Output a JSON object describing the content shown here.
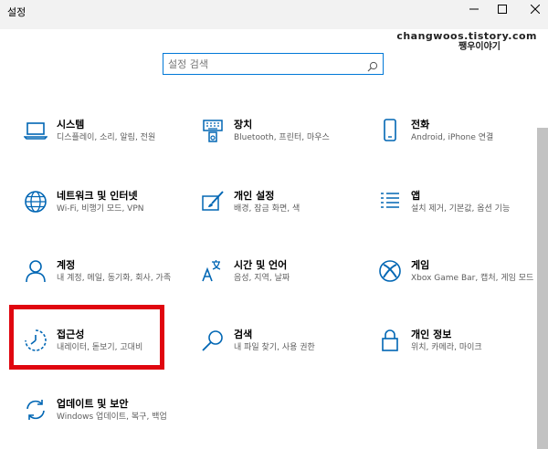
{
  "window": {
    "title": "설정"
  },
  "watermark": {
    "line1": "changwoos.tistory.com",
    "line2": "쨍우이야기"
  },
  "search": {
    "placeholder": "설정 검색",
    "value": ""
  },
  "colors": {
    "accent": "#0078d7",
    "highlight": "#e0060f"
  },
  "tiles": [
    {
      "id": "system",
      "name": "시스템",
      "desc": "디스플레이, 소리, 알림, 전원",
      "icon": "laptop-icon"
    },
    {
      "id": "devices",
      "name": "장치",
      "desc": "Bluetooth, 프린터, 마우스",
      "icon": "keyboard-icon"
    },
    {
      "id": "phone",
      "name": "전화",
      "desc": "Android, iPhone 연결",
      "icon": "phone-icon"
    },
    {
      "id": "network",
      "name": "네트워크 및 인터넷",
      "desc": "Wi-Fi, 비행기 모드, VPN",
      "icon": "globe-icon"
    },
    {
      "id": "personalization",
      "name": "개인 설정",
      "desc": "배경, 잠금 화면, 색",
      "icon": "brush-icon"
    },
    {
      "id": "apps",
      "name": "앱",
      "desc": "설치 제거, 기본값, 옵션 기능",
      "icon": "apps-list-icon"
    },
    {
      "id": "accounts",
      "name": "계정",
      "desc": "내 계정, 메일, 동기화, 회사, 가족",
      "icon": "person-icon"
    },
    {
      "id": "time-language",
      "name": "시간 및 언어",
      "desc": "음성, 지역, 날짜",
      "icon": "language-icon"
    },
    {
      "id": "gaming",
      "name": "게임",
      "desc": "Xbox Game Bar, 캡처, 게임 모드",
      "icon": "xbox-icon"
    },
    {
      "id": "ease-of-access",
      "name": "접근성",
      "desc": "내레이터, 돋보기, 고대비",
      "icon": "ease-of-access-icon"
    },
    {
      "id": "search-settings",
      "name": "검색",
      "desc": "내 파일 찾기, 사용 권한",
      "icon": "magnifier-icon"
    },
    {
      "id": "privacy",
      "name": "개인 정보",
      "desc": "위치, 카메라, 마이크",
      "icon": "lock-icon"
    },
    {
      "id": "update",
      "name": "업데이트 및 보안",
      "desc": "Windows 업데이트, 복구, 백업",
      "icon": "sync-icon"
    }
  ]
}
